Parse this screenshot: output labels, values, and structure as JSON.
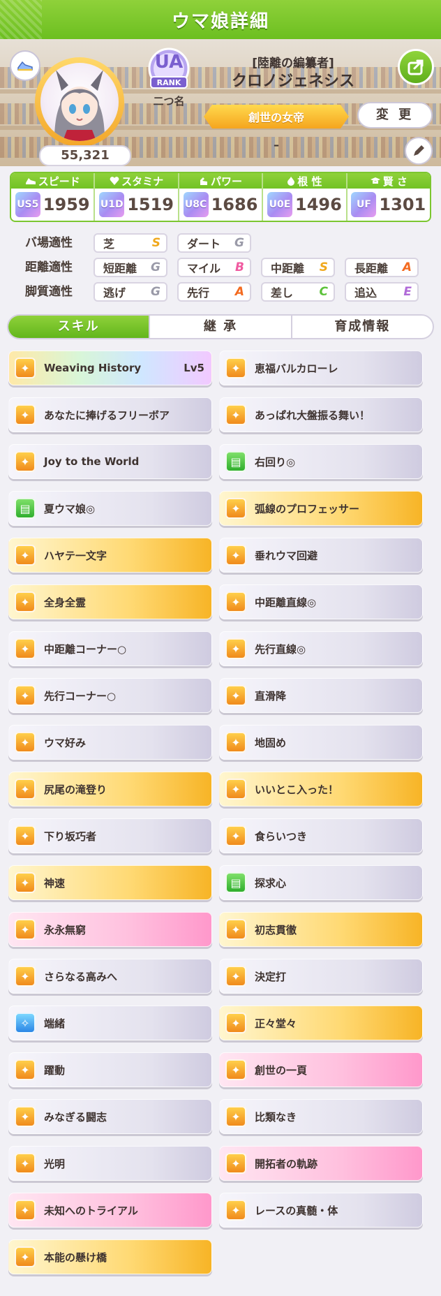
{
  "header": {
    "title": "ウマ娘詳細"
  },
  "profile": {
    "fan_count": "55,321",
    "rank_badge": "UA",
    "rank_label": "RANK",
    "rank_name": "二つ名",
    "outfit_title": "[陸離の編纂者]",
    "name": "クロノジェネシス",
    "epithet": "創世の女帝",
    "memo": "–",
    "change_label": "変 更"
  },
  "stats": [
    {
      "label": "スピード",
      "icon": "shoe-icon",
      "grade": "US5",
      "value": "1959"
    },
    {
      "label": "スタミナ",
      "icon": "heart-icon",
      "grade": "U1D",
      "value": "1519"
    },
    {
      "label": "パワー",
      "icon": "muscle-icon",
      "grade": "U8C",
      "value": "1686"
    },
    {
      "label": "根 性",
      "icon": "flame-icon",
      "grade": "U0E",
      "value": "1496"
    },
    {
      "label": "賢 さ",
      "icon": "graduation-icon",
      "grade": "UF",
      "value": "1301"
    }
  ],
  "aptitude": {
    "track_label": "バ場適性",
    "distance_label": "距離適性",
    "style_label": "脚質適性",
    "track": [
      {
        "name": "芝",
        "grade": "S"
      },
      {
        "name": "ダート",
        "grade": "G"
      }
    ],
    "distance": [
      {
        "name": "短距離",
        "grade": "G"
      },
      {
        "name": "マイル",
        "grade": "B"
      },
      {
        "name": "中距離",
        "grade": "S"
      },
      {
        "name": "長距離",
        "grade": "A"
      }
    ],
    "style": [
      {
        "name": "逃げ",
        "grade": "G"
      },
      {
        "name": "先行",
        "grade": "A"
      },
      {
        "name": "差し",
        "grade": "C"
      },
      {
        "name": "追込",
        "grade": "E"
      }
    ]
  },
  "grade_colors": {
    "S": "#f0a81c",
    "A": "#f36a1f",
    "B": "#f05aa0",
    "C": "#5cc23a",
    "D": "#3da0e8",
    "E": "#b06ad8",
    "G": "#9a9aa8"
  },
  "tabs": [
    "スキル",
    "継 承",
    "育成情報"
  ],
  "skills": [
    {
      "name": "Weaving History",
      "level": "Lv5",
      "style": "unique",
      "icon": "speed"
    },
    {
      "name": "恵福バルカローレ",
      "level": "",
      "style": "normal",
      "icon": "speed"
    },
    {
      "name": "あなたに捧げるフリーボア",
      "level": "",
      "style": "normal",
      "icon": "speed"
    },
    {
      "name": "あっぱれ大盤振る舞い！",
      "level": "",
      "style": "normal",
      "icon": "speed"
    },
    {
      "name": "Joy to the World",
      "level": "",
      "style": "normal",
      "icon": "speed"
    },
    {
      "name": "右回り◎",
      "level": "",
      "style": "normal",
      "icon": "green"
    },
    {
      "name": "夏ウマ娘◎",
      "level": "",
      "style": "normal",
      "icon": "green"
    },
    {
      "name": "弧線のプロフェッサー",
      "level": "",
      "style": "gold",
      "icon": "speed"
    },
    {
      "name": "ハヤテ一文字",
      "level": "",
      "style": "gold",
      "icon": "speed"
    },
    {
      "name": "垂れウマ回避",
      "level": "",
      "style": "normal",
      "icon": "speed"
    },
    {
      "name": "全身全霊",
      "level": "",
      "style": "gold",
      "icon": "speed"
    },
    {
      "name": "中距離直線◎",
      "level": "",
      "style": "normal",
      "icon": "speed"
    },
    {
      "name": "中距離コーナー○",
      "level": "",
      "style": "normal",
      "icon": "speed"
    },
    {
      "name": "先行直線◎",
      "level": "",
      "style": "normal",
      "icon": "speed"
    },
    {
      "name": "先行コーナー○",
      "level": "",
      "style": "normal",
      "icon": "speed"
    },
    {
      "name": "直滑降",
      "level": "",
      "style": "normal",
      "icon": "speed"
    },
    {
      "name": "ウマ好み",
      "level": "",
      "style": "normal",
      "icon": "speed"
    },
    {
      "name": "地固め",
      "level": "",
      "style": "normal",
      "icon": "speed"
    },
    {
      "name": "尻尾の滝登り",
      "level": "",
      "style": "gold",
      "icon": "speed"
    },
    {
      "name": "いいとこ入った！",
      "level": "",
      "style": "gold",
      "icon": "speed"
    },
    {
      "name": "下り坂巧者",
      "level": "",
      "style": "normal",
      "icon": "speed"
    },
    {
      "name": "食らいつき",
      "level": "",
      "style": "normal",
      "icon": "speed"
    },
    {
      "name": "神速",
      "level": "",
      "style": "gold",
      "icon": "speed"
    },
    {
      "name": "探求心",
      "level": "",
      "style": "normal",
      "icon": "green"
    },
    {
      "name": "永永無窮",
      "level": "",
      "style": "pink",
      "icon": "speed"
    },
    {
      "name": "初志貫徹",
      "level": "",
      "style": "gold",
      "icon": "speed"
    },
    {
      "name": "さらなる高みへ",
      "level": "",
      "style": "normal",
      "icon": "speed"
    },
    {
      "name": "決定打",
      "level": "",
      "style": "normal",
      "icon": "speed"
    },
    {
      "name": "端緒",
      "level": "",
      "style": "normal",
      "icon": "blue"
    },
    {
      "name": "正々堂々",
      "level": "",
      "style": "gold",
      "icon": "speed"
    },
    {
      "name": "躍動",
      "level": "",
      "style": "normal",
      "icon": "speed"
    },
    {
      "name": "創世の一頁",
      "level": "",
      "style": "pink",
      "icon": "speed"
    },
    {
      "name": "みなぎる闘志",
      "level": "",
      "style": "normal",
      "icon": "speed"
    },
    {
      "name": "比類なき",
      "level": "",
      "style": "normal",
      "icon": "speed"
    },
    {
      "name": "光明",
      "level": "",
      "style": "normal",
      "icon": "speed"
    },
    {
      "name": "開拓者の軌跡",
      "level": "",
      "style": "pink",
      "icon": "speed"
    },
    {
      "name": "未知へのトライアル",
      "level": "",
      "style": "pink",
      "icon": "speed"
    },
    {
      "name": "レースの真髄・体",
      "level": "",
      "style": "normal",
      "icon": "speed"
    },
    {
      "name": "本能の懸け橋",
      "level": "",
      "style": "gold",
      "icon": "speed"
    }
  ]
}
